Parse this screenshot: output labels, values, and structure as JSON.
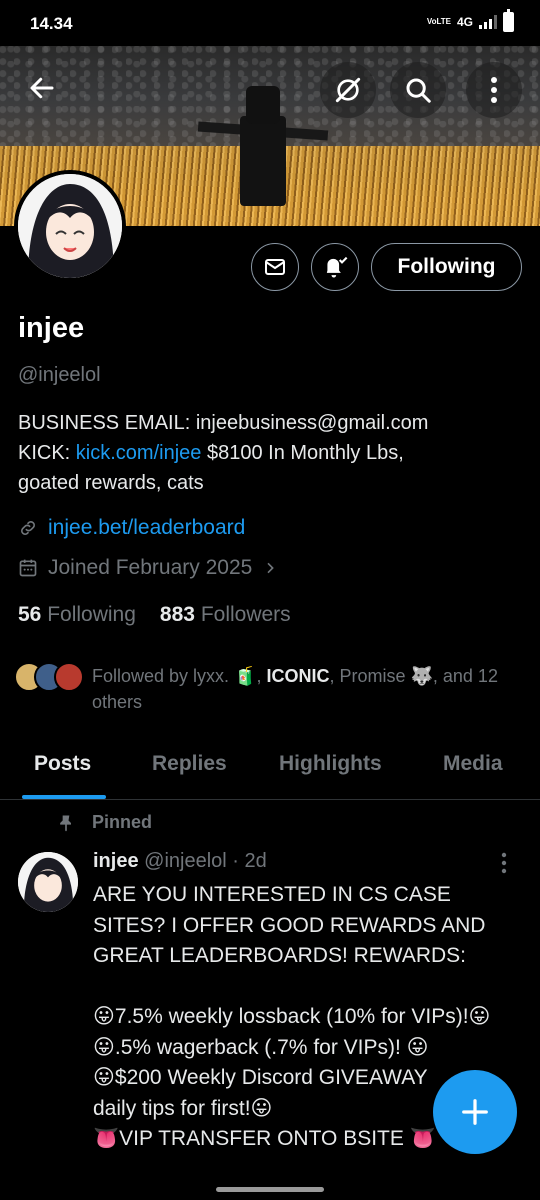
{
  "status_bar": {
    "time": "14.34",
    "volte": "VoLTE",
    "network": "4G"
  },
  "header": {
    "back_icon": "arrow-left-icon",
    "grok_icon": "grok-icon",
    "search_icon": "search-icon",
    "more_icon": "more-vertical-icon"
  },
  "profile": {
    "name": "injee",
    "handle": "@injeelol",
    "bio_line1": "BUSINESS EMAIL: injeebusiness@gmail.com",
    "bio_kick_prefix": "KICK: ",
    "bio_kick_link": "kick.com/injee",
    "bio_kick_suffix": " $8100 In Monthly Lbs,",
    "bio_line3": "goated rewards, cats",
    "website": "injee.bet/leaderboard",
    "joined": "Joined February 2025",
    "following_count": "56",
    "following_label": "Following",
    "followers_count": "883",
    "followers_label": "Followers",
    "follow_button": "Following",
    "followed_by_prefix": "Followed by lyxx. 🧃, ",
    "followed_by_bold": "ICONIC",
    "followed_by_suffix": ", Promise 🐺, and 12 others"
  },
  "tabs": [
    {
      "label": "Posts",
      "active": true
    },
    {
      "label": "Replies",
      "active": false
    },
    {
      "label": "Highlights",
      "active": false
    },
    {
      "label": "Media",
      "active": false
    }
  ],
  "pinned_tweet": {
    "pinned_label": "Pinned",
    "author_name": "injee",
    "author_handle": "@injeelol",
    "time": " · 2d",
    "text": "ARE YOU INTERESTED IN CS CASE SITES? I OFFER GOOD REWARDS AND GREAT LEADERBOARDS! REWARDS:\n\n😛7.5% weekly lossback (10% for VIPs)!😛\n😛.5% wagerback (.7% for VIPs)! 😛\n😛$200 Weekly Discord GIVEAWAY\ndaily tips for first!😛\n👅VIP TRANSFER ONTO BSITE 👅"
  },
  "colors": {
    "accent": "#1d9bf0",
    "muted": "#71767b",
    "text": "#e7e9ea"
  }
}
